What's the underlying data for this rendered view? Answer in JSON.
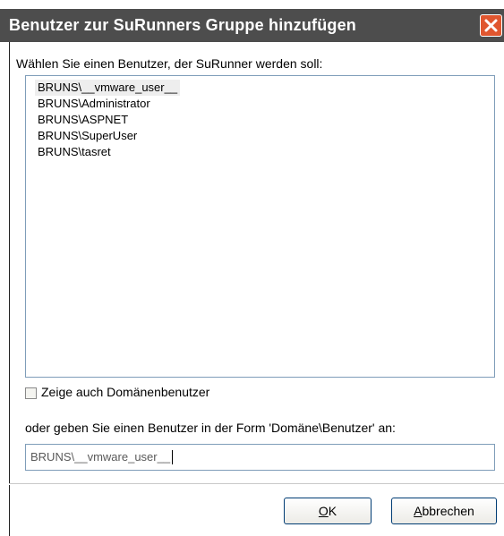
{
  "window": {
    "title": "Benutzer zur SuRunners Gruppe hinzufügen",
    "close_icon": "close-x-icon",
    "titlebar_color": "#4d4d4d",
    "close_color": "#e0562f"
  },
  "prompt": "Wählen Sie einen Benutzer, der SuRunner werden soll:",
  "users": [
    "BRUNS\\__vmware_user__",
    "BRUNS\\Administrator",
    "BRUNS\\ASPNET",
    "BRUNS\\SuperUser",
    "BRUNS\\tasret"
  ],
  "selected_user_index": 0,
  "domain_checkbox": {
    "label": "Zeige auch Domänenbenutzer",
    "checked": false
  },
  "manual_entry": {
    "label": "oder geben Sie einen Benutzer in der Form 'Domäne\\Benutzer' an:",
    "value": "BRUNS\\__vmware_user__"
  },
  "buttons": {
    "ok_mnemonic": "O",
    "ok_rest": "K",
    "cancel_mnemonic": "A",
    "cancel_rest": "bbrechen"
  }
}
